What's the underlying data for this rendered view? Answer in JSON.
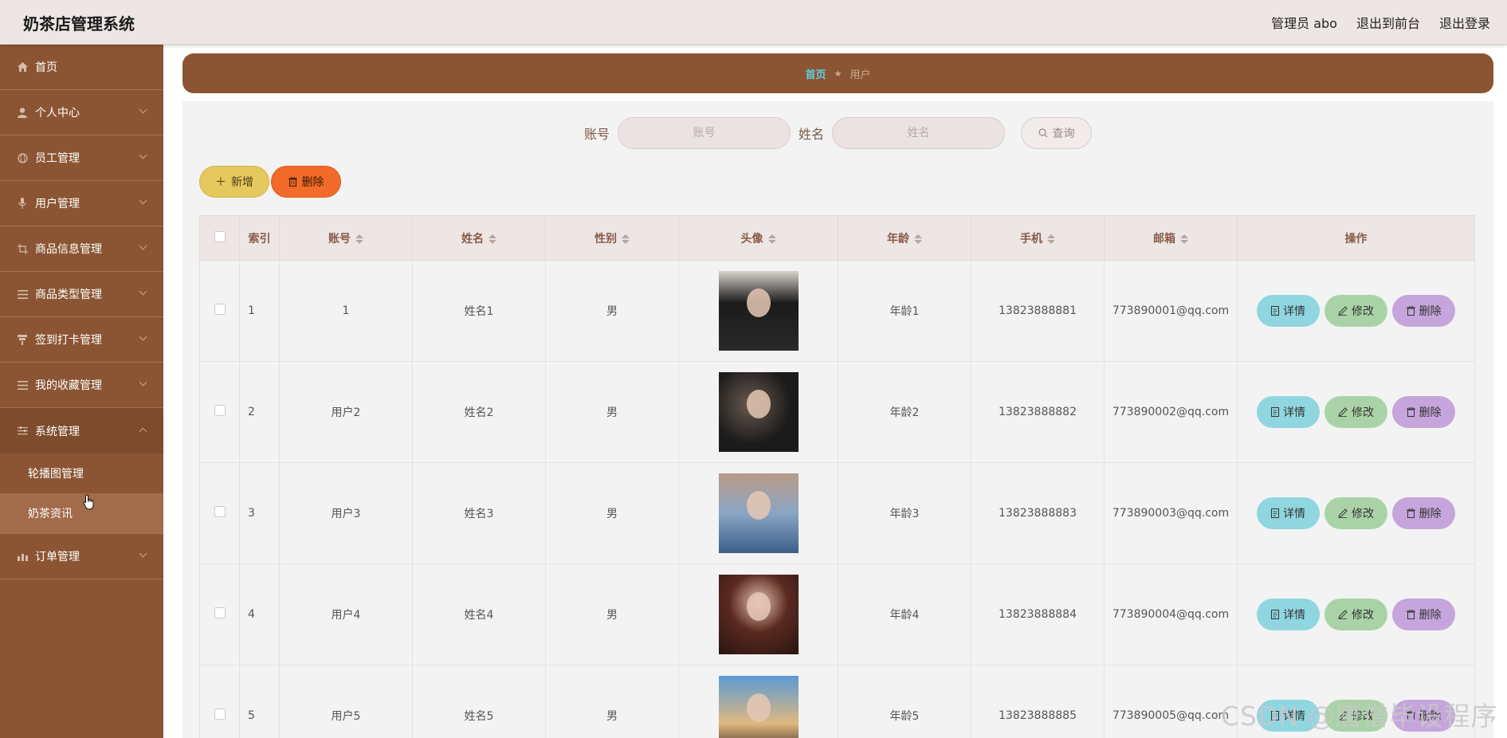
{
  "app": {
    "title": "奶茶店管理系统",
    "top_links": [
      "管理员 abo",
      "退出到前台",
      "退出登录"
    ]
  },
  "sidebar": {
    "items": [
      {
        "label": "首页",
        "icon": "home-icon",
        "has_arrow": false
      },
      {
        "label": "个人中心",
        "icon": "user-icon",
        "has_arrow": true
      },
      {
        "label": "员工管理",
        "icon": "globe-icon",
        "has_arrow": true
      },
      {
        "label": "用户管理",
        "icon": "mic-icon",
        "has_arrow": true
      },
      {
        "label": "商品信息管理",
        "icon": "crop-icon",
        "has_arrow": true
      },
      {
        "label": "商品类型管理",
        "icon": "list-icon",
        "has_arrow": true
      },
      {
        "label": "签到打卡管理",
        "icon": "pin-icon",
        "has_arrow": true
      },
      {
        "label": "我的收藏管理",
        "icon": "list-icon",
        "has_arrow": true
      },
      {
        "label": "系统管理",
        "icon": "sliders-icon",
        "has_arrow": true,
        "expanded": true
      },
      {
        "label": "订单管理",
        "icon": "chart-icon",
        "has_arrow": true
      }
    ],
    "sub_items": [
      "轮播图管理",
      "奶茶资讯"
    ]
  },
  "breadcrumb": {
    "home": "首页",
    "current": "用户"
  },
  "search": {
    "account_label": "账号",
    "account_placeholder": "账号",
    "name_label": "姓名",
    "name_placeholder": "姓名",
    "button": "查询"
  },
  "actions": {
    "add": "新增",
    "delete": "删除"
  },
  "table": {
    "headers": [
      "索引",
      "账号",
      "姓名",
      "性别",
      "头像",
      "年龄",
      "手机",
      "邮箱",
      "操作"
    ],
    "rows": [
      {
        "index": "1",
        "account": "1",
        "name": "姓名1",
        "gender": "男",
        "age": "年龄1",
        "phone": "13823888881",
        "email": "773890001@qq.com"
      },
      {
        "index": "2",
        "account": "用户2",
        "name": "姓名2",
        "gender": "男",
        "age": "年龄2",
        "phone": "13823888882",
        "email": "773890002@qq.com"
      },
      {
        "index": "3",
        "account": "用户3",
        "name": "姓名3",
        "gender": "男",
        "age": "年龄3",
        "phone": "13823888883",
        "email": "773890003@qq.com"
      },
      {
        "index": "4",
        "account": "用户4",
        "name": "姓名4",
        "gender": "男",
        "age": "年龄4",
        "phone": "13823888884",
        "email": "773890004@qq.com"
      },
      {
        "index": "5",
        "account": "用户5",
        "name": "姓名5",
        "gender": "男",
        "age": "年龄5",
        "phone": "13823888885",
        "email": "773890005@qq.com"
      }
    ],
    "row_actions": {
      "detail": "详情",
      "edit": "修改",
      "delete": "删除"
    }
  },
  "watermark": "CSDN @唐僧毕设程序",
  "colors": {
    "sidebar_bg": "#8b5533",
    "header_bg": "#ede6e5",
    "add_button": "#e6c95e",
    "delete_button": "#f26b2a",
    "detail_button": "#8fd6e0",
    "edit_button": "#a9d3a6",
    "row_delete_button": "#c5a5dc"
  }
}
